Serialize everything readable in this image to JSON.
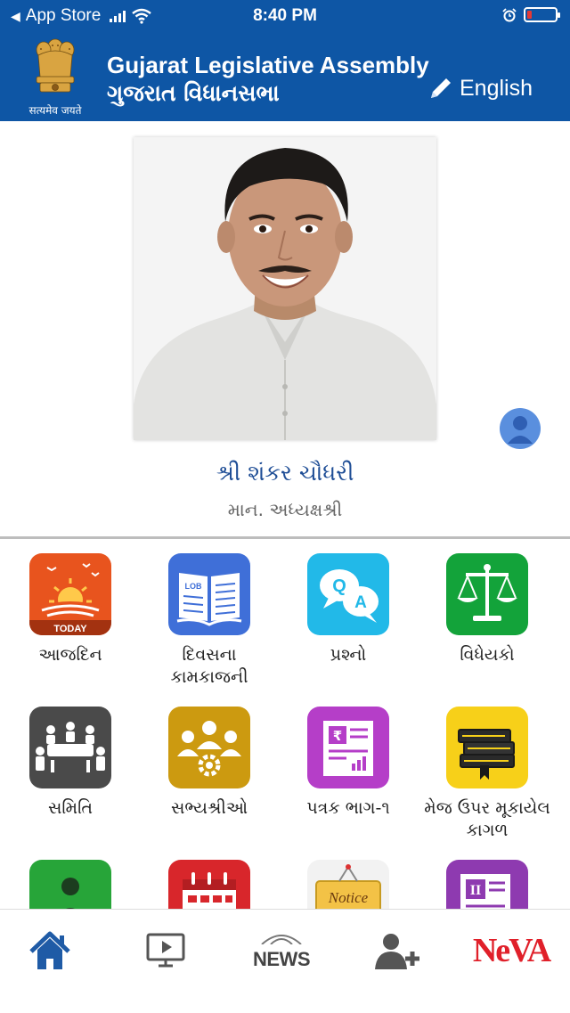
{
  "status_bar": {
    "back_app": "App Store",
    "time": "8:40 PM"
  },
  "header": {
    "emblem_motto": "सत्यमेव जयते",
    "title_en": "Gujarat Legislative Assembly",
    "title_gu": "ગુજરાત વિધાનસભા",
    "language_button": "English",
    "colors": {
      "brand_blue": "#0e56a5"
    }
  },
  "speaker": {
    "name": "શ્રી શંકર ચૌધરી",
    "designation": "માન. અધ્યક્ષશ્રી"
  },
  "menu": [
    {
      "label": "આજદિન",
      "icon": "today-sunrise-icon",
      "badge": "TODAY"
    },
    {
      "label": "દિવસના કામકાજની",
      "icon": "lob-book-icon",
      "badge": "LOB"
    },
    {
      "label": "પ્રશ્નો",
      "icon": "qa-chat-icon",
      "badge": "Q A"
    },
    {
      "label": "વિધેયકો",
      "icon": "scales-icon"
    },
    {
      "label": "સમિતિ",
      "icon": "committee-meeting-icon"
    },
    {
      "label": "સભ્યશ્રીઓ",
      "icon": "members-icon"
    },
    {
      "label": "પત્રક ભાગ-૧",
      "icon": "report-document-icon"
    },
    {
      "label": "મેજ ઉપર મૂકાયેલ કાગળ",
      "icon": "books-stack-icon"
    },
    {
      "label": "",
      "icon": "person-icon"
    },
    {
      "label": "",
      "icon": "calendar-icon"
    },
    {
      "label": "",
      "icon": "notice-board-icon",
      "badge": "Notice"
    },
    {
      "label": "",
      "icon": "document-ii-icon",
      "badge": "II"
    }
  ],
  "bottom_nav": {
    "items": [
      {
        "name": "home-icon"
      },
      {
        "name": "video-icon"
      },
      {
        "name": "news-icon",
        "label": "NEWS"
      },
      {
        "name": "add-user-icon"
      },
      {
        "name": "neva-logo",
        "label": "NeVA"
      }
    ]
  }
}
